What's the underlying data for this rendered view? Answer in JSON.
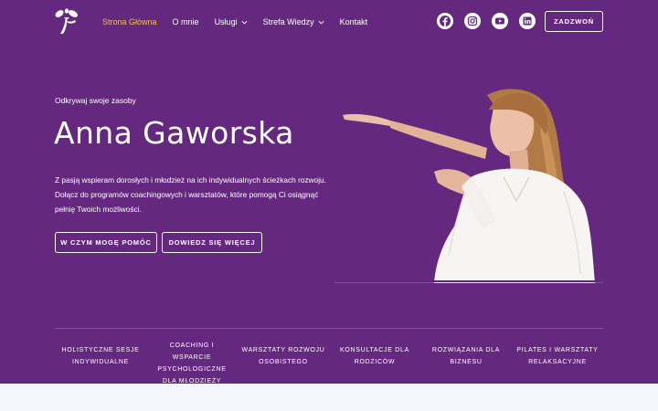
{
  "colors": {
    "hero_bg": "#64287e",
    "active_nav": "#f4c542",
    "text": "#ffffff",
    "page_bg": "#f4f7fb"
  },
  "header": {
    "logo_icon": "figure-logo-icon",
    "nav": [
      {
        "label": "Strona Główna",
        "active": true
      },
      {
        "label": "O mnie"
      },
      {
        "label": "Usługi",
        "dropdown": true
      },
      {
        "label": "Strefa Wiedzy",
        "dropdown": true
      },
      {
        "label": "Kontakt"
      }
    ],
    "social": [
      "facebook-icon",
      "instagram-icon",
      "youtube-icon",
      "linkedin-icon"
    ],
    "call_label": "ZADZWOŃ"
  },
  "hero": {
    "eyebrow": "Odkrywaj swoje zasoby",
    "title": "Anna Gaworska",
    "description": [
      "Z pasją wspieram dorosłych i młodzież na ich indywidualnych ścieżkach rozwoju.",
      "Dołącz do programów coachingowych i warsztatów, które pomogą Ci osiągnąć",
      "pełnię Twoich możliwości."
    ],
    "buttons": [
      "W CZYM MOGĘ POMÓC",
      "DOWIEDZ SIĘ WIĘCEJ"
    ]
  },
  "services": [
    "Holistyczne sesje indywidualne",
    "Coaching i wsparcie psychologiczne dla młodzieży",
    "Warsztaty rozwoju osobistego",
    "Konsultacje dla rodziców",
    "Rozwiązania dla biznesu",
    "Pilates i warsztaty relaksacyjne"
  ]
}
